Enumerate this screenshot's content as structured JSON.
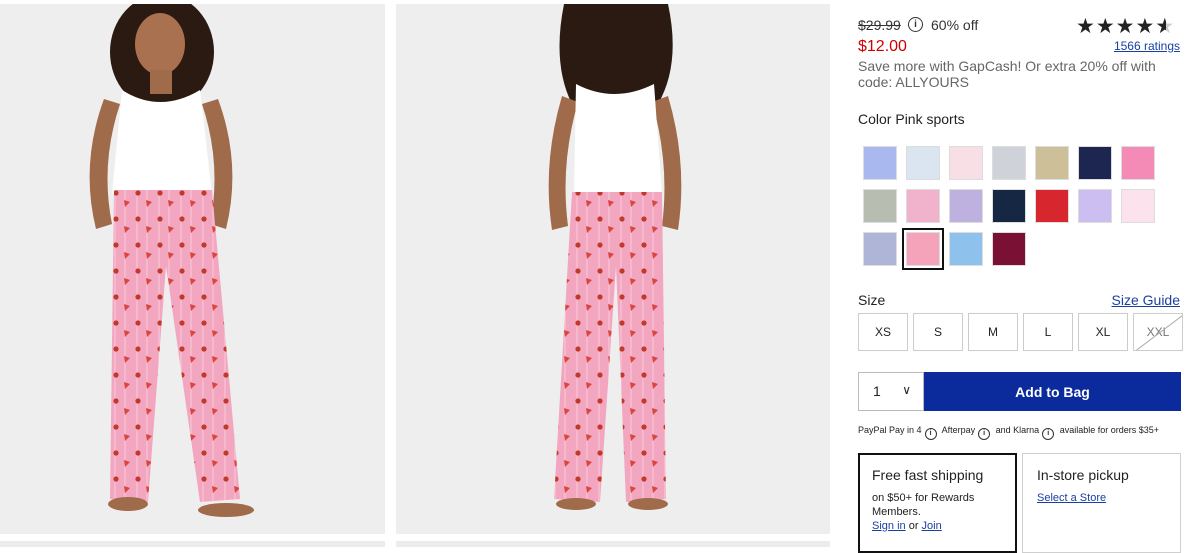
{
  "pricing": {
    "original_price": "$29.99",
    "discount_label": "60% off",
    "sale_price": "$12.00",
    "promo_text": "Save more with GapCash! Or extra 20% off with code: ALLYOURS"
  },
  "rating": {
    "value": 4.5,
    "count_label": "1566 ratings"
  },
  "color": {
    "label": "Color",
    "selected_name": "Pink sports",
    "swatch_names": [
      "blue-stripe",
      "light-blue-print",
      "pink-hearts",
      "gray-heart",
      "khaki-stripe",
      "navy-dots",
      "pink-stripe",
      "gray-plaid",
      "pink-cherries",
      "purple-plaid",
      "navy-floral",
      "red-plaid",
      "lavender-print",
      "light-pink-print",
      "navy-stripe",
      "pink-sports",
      "blue-rainbow",
      "burgundy-print"
    ],
    "swatch_colors": [
      "#a9b8ee",
      "#dbe4f1",
      "#f8dfe5",
      "#cfd2d9",
      "#cdbf98",
      "#1c2650",
      "#f48bb6",
      "#b8bdb2",
      "#f1b3cc",
      "#bfb1df",
      "#162744",
      "#d8262f",
      "#cdbef2",
      "#fbe2ec",
      "#aeb5d6",
      "#f5a3bb",
      "#8ec2ec",
      "#7a1033"
    ],
    "selected_index": 15
  },
  "size": {
    "label": "Size",
    "guide_label": "Size Guide",
    "options": [
      "XS",
      "S",
      "M",
      "L",
      "XL",
      "XXL"
    ],
    "unavailable": [
      "XXL"
    ]
  },
  "cart": {
    "quantity": "1",
    "add_label": "Add to Bag"
  },
  "payment": {
    "paypal": "PayPal Pay in 4",
    "afterpay": "Afterpay",
    "and": "and",
    "klarna": "Klarna",
    "note": "available for orders $35+"
  },
  "shipping": {
    "title": "Free fast shipping",
    "text": "on $50+ for Rewards Members.",
    "signin": "Sign in",
    "or": "or",
    "join": "Join"
  },
  "pickup": {
    "title": "In-store pickup",
    "link": "Select a Store"
  },
  "colors": {
    "sale_red": "#d00000",
    "link_blue": "#1a3fa3",
    "button_navy": "#0b2a9c",
    "pants_pink": "#f2a4bd"
  }
}
